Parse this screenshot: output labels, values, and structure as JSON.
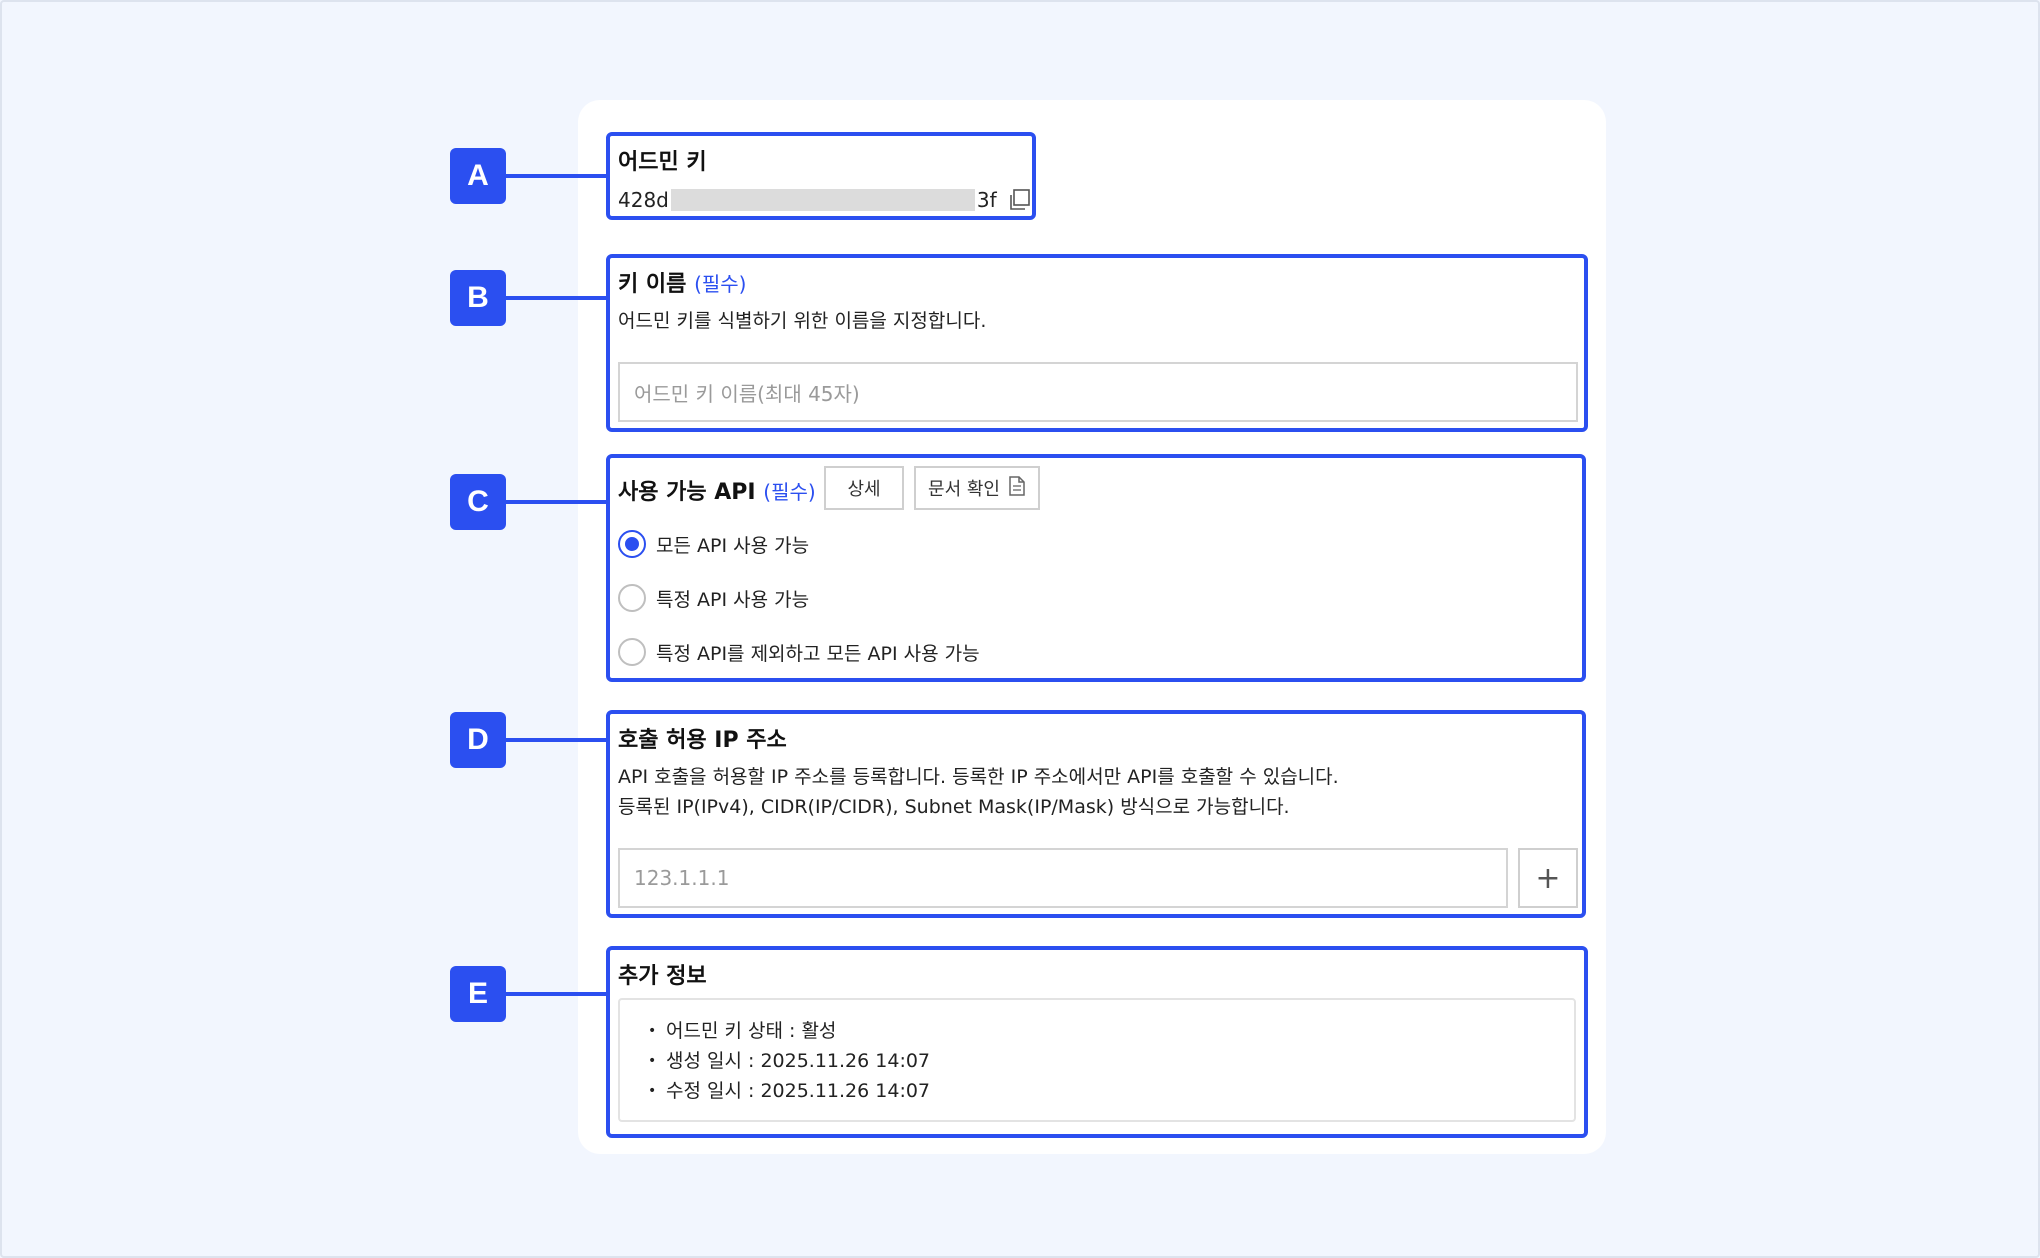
{
  "markers": [
    "A",
    "B",
    "C",
    "D",
    "E"
  ],
  "admin_key": {
    "title": "어드민 키",
    "prefix": "428d",
    "suffix": "3f",
    "copy_icon": "copy-icon"
  },
  "key_name": {
    "title": "키 이름",
    "required": "(필수)",
    "description": "어드민 키를 식별하기 위한 이름을 지정합니다.",
    "placeholder": "어드민 키 이름(최대 45자)"
  },
  "api": {
    "title": "사용 가능 API",
    "required": "(필수)",
    "detail_button": "상세",
    "docs_button": "문서 확인",
    "docs_icon": "document-icon",
    "options": [
      {
        "label": "모든 API 사용 가능",
        "checked": true
      },
      {
        "label": "특정 API 사용 가능",
        "checked": false
      },
      {
        "label": "특정 API를 제외하고 모든 API 사용 가능",
        "checked": false
      }
    ]
  },
  "ip": {
    "title": "호출 허용 IP 주소",
    "description_1": "API 호출을 허용할 IP 주소를 등록합니다. 등록한 IP 주소에서만 API를 호출할 수 있습니다.",
    "description_2": "등록된 IP(IPv4), CIDR(IP/CIDR), Subnet Mask(IP/Mask) 방식으로 가능합니다.",
    "placeholder": "123.1.1.1",
    "add_button": "+"
  },
  "extra": {
    "title": "추가 정보",
    "items": [
      "어드민 키 상태 : 활성",
      "생성 일시 : 2025.11.26 14:07",
      "수정 일시 : 2025.11.26 14:07"
    ]
  },
  "colors": {
    "accent": "#2b4ff0",
    "background": "#f2f6fe"
  }
}
